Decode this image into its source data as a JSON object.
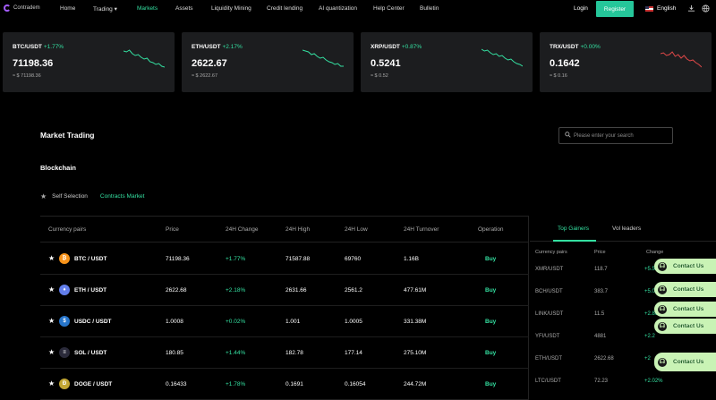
{
  "nav": {
    "logo": "Contradem",
    "items": [
      "Home",
      "Trading",
      "Markets",
      "Assets",
      "Liquidity Mining",
      "Credit lending",
      "AI quantization",
      "Help Center",
      "Bulletin"
    ],
    "login": "Login",
    "register": "Register",
    "language": "English"
  },
  "tickers": [
    {
      "pair": "BTC/USDT",
      "change": "+1.77%",
      "price": "71198.36",
      "usd": "≈ $ 71198.36",
      "trend": "down",
      "spark": [
        9,
        10,
        8,
        12,
        14,
        13,
        16,
        18,
        17,
        21,
        22,
        24,
        23,
        26,
        27
      ]
    },
    {
      "pair": "ETH/USDT",
      "change": "+2.17%",
      "price": "2622.67",
      "usd": "≈ $ 2622.67",
      "trend": "down",
      "spark": [
        8,
        9,
        10,
        13,
        12,
        15,
        17,
        16,
        19,
        21,
        22,
        24,
        23,
        26,
        26
      ]
    },
    {
      "pair": "XRP/USDT",
      "change": "+0.87%",
      "price": "0.5241",
      "usd": "≈ $ 0.52",
      "trend": "down",
      "spark": [
        7,
        9,
        8,
        11,
        13,
        12,
        15,
        14,
        17,
        19,
        18,
        21,
        23,
        24,
        26
      ]
    },
    {
      "pair": "TRX/USDT",
      "change": "+0.00%",
      "price": "0.1642",
      "usd": "≈ $ 0.16",
      "trend": "flat",
      "spark": [
        12,
        11,
        14,
        13,
        10,
        15,
        13,
        17,
        14,
        18,
        20,
        19,
        22,
        24,
        27
      ]
    }
  ],
  "market": {
    "title": "Market Trading",
    "search_placeholder": "Please enter your search",
    "subtitle": "Blockchain",
    "tab_self": "Self Selection",
    "tab_contracts": "Contracts Market"
  },
  "table": {
    "headers": [
      "Currency pairs",
      "Price",
      "24H Change",
      "24H High",
      "24H Low",
      "24H Turnover",
      "Operation"
    ],
    "rows": [
      {
        "pair": "BTC / USDT",
        "icon": "bitcoin-icon",
        "color": "#f7931a",
        "glyph": "₿",
        "price": "71198.36",
        "change": "+1.77%",
        "high": "71587.88",
        "low": "69760",
        "turnover": "1.16B",
        "op": "Buy"
      },
      {
        "pair": "ETH / USDT",
        "icon": "ethereum-icon",
        "color": "#627eea",
        "glyph": "♦",
        "price": "2622.68",
        "change": "+2.18%",
        "high": "2631.66",
        "low": "2561.2",
        "turnover": "477.61M",
        "op": "Buy"
      },
      {
        "pair": "USDC / USDT",
        "icon": "usdc-icon",
        "color": "#2775ca",
        "glyph": "$",
        "price": "1.0008",
        "change": "+0.02%",
        "high": "1.001",
        "low": "1.0005",
        "turnover": "331.38M",
        "op": "Buy"
      },
      {
        "pair": "SOL / USDT",
        "icon": "solana-icon",
        "color": "#2a2a3a",
        "glyph": "≡",
        "price": "180.85",
        "change": "+1.44%",
        "high": "182.78",
        "low": "177.14",
        "turnover": "275.10M",
        "op": "Buy"
      },
      {
        "pair": "DOGE / USDT",
        "icon": "dogecoin-icon",
        "color": "#c2a633",
        "glyph": "Ð",
        "price": "0.16433",
        "change": "+1.78%",
        "high": "0.1691",
        "low": "0.16054",
        "turnover": "244.72M",
        "op": "Buy"
      }
    ]
  },
  "gainers": {
    "tab_top": "Top Gainers",
    "tab_vol": "Vol leaders",
    "headers": [
      "Currency pairs",
      "Price",
      "Change"
    ],
    "rows": [
      {
        "pair": "XMR/USDT",
        "price": "118.7",
        "change": "+5.51%"
      },
      {
        "pair": "BCH/USDT",
        "price": "383.7",
        "change": "+5.04%"
      },
      {
        "pair": "LINK/USDT",
        "price": "11.5",
        "change": "+2.86%"
      },
      {
        "pair": "YFI/USDT",
        "price": "4881",
        "change": "+2.2"
      },
      {
        "pair": "ETH/USDT",
        "price": "2622.68",
        "change": "+2"
      },
      {
        "pair": "LTC/USDT",
        "price": "72.23",
        "change": "+2.02%"
      }
    ]
  },
  "contact_label": "Contact Us",
  "colors": {
    "accent": "#34e0a1",
    "register": "#25c69a",
    "down": "#e04848",
    "contact": "#c9f3b5"
  }
}
